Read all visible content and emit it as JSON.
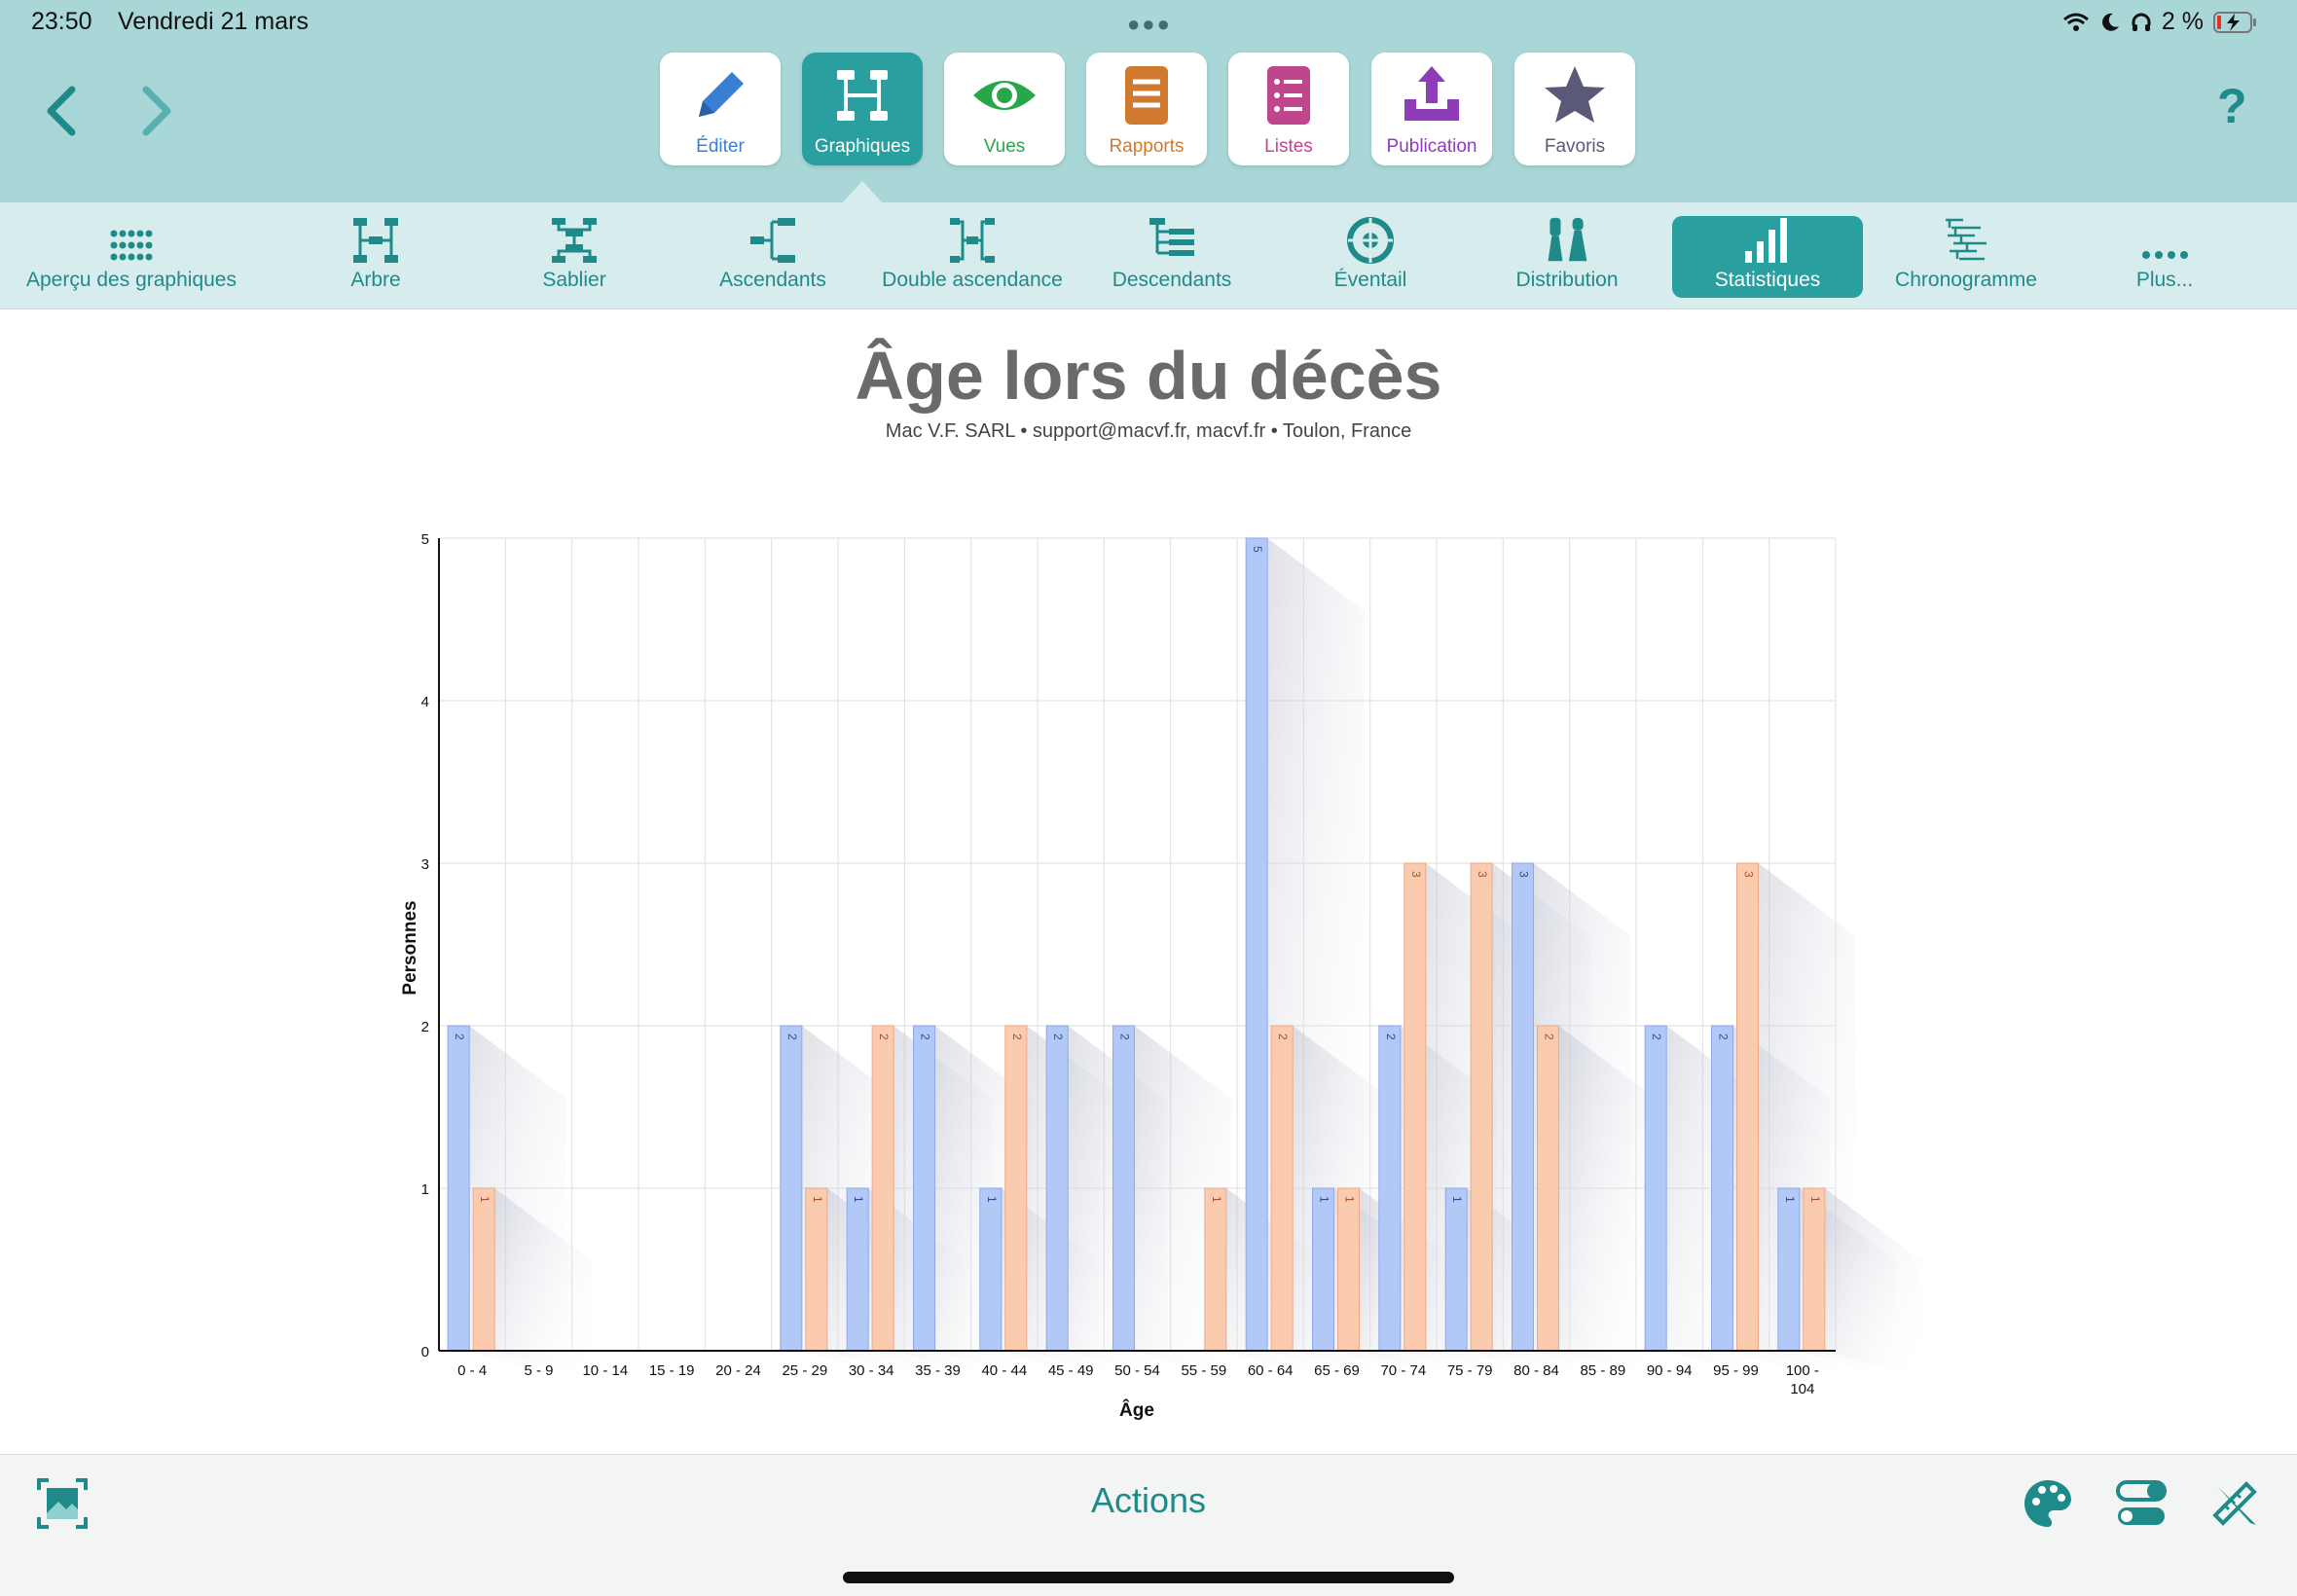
{
  "status_bar": {
    "time": "23:50",
    "date": "Vendredi 21 mars",
    "battery": "2 %"
  },
  "toolbar": {
    "modes": [
      {
        "label": "Éditer",
        "icon": "pencil-icon",
        "color": "#3a7fd4"
      },
      {
        "label": "Graphiques",
        "icon": "tree-chart-icon",
        "color": "#ffffff",
        "active": true
      },
      {
        "label": "Vues",
        "icon": "eye-icon",
        "color": "#2aa64a"
      },
      {
        "label": "Rapports",
        "icon": "report-icon",
        "color": "#d07a30"
      },
      {
        "label": "Listes",
        "icon": "list-icon",
        "color": "#c0468c"
      },
      {
        "label": "Publication",
        "icon": "upload-icon",
        "color": "#8e3cb8"
      },
      {
        "label": "Favoris",
        "icon": "star-icon",
        "color": "#5a5a78"
      }
    ],
    "help": "?"
  },
  "subbar": {
    "items": [
      {
        "label": "Aperçu des graphiques",
        "icon": "grid-dots-icon"
      },
      {
        "label": "Arbre",
        "icon": "tree-icon"
      },
      {
        "label": "Sablier",
        "icon": "hourglass-icon"
      },
      {
        "label": "Ascendants",
        "icon": "ancestors-icon"
      },
      {
        "label": "Double ascendance",
        "icon": "double-ancestry-icon"
      },
      {
        "label": "Descendants",
        "icon": "descendants-icon"
      },
      {
        "label": "Éventail",
        "icon": "fan-icon"
      },
      {
        "label": "Distribution",
        "icon": "distribution-icon"
      },
      {
        "label": "Statistiques",
        "icon": "bar-stats-icon",
        "active": true
      },
      {
        "label": "Chronogramme",
        "icon": "timeline-icon"
      },
      {
        "label": "Plus...",
        "icon": "more-dots-icon"
      }
    ]
  },
  "bottom_bar": {
    "actions_label": "Actions"
  },
  "colors": {
    "accent": "#1f8a8a",
    "toolbar_bg": "#a9d7d7",
    "subbar_bg": "#d7eded",
    "bar_blue": "#b2c8f6",
    "bar_orange": "#fbcbb0"
  },
  "chart_data": {
    "type": "bar",
    "title": "Âge lors du décès",
    "subtitle": "Mac V.F. SARL • support@macvf.fr, macvf.fr • Toulon, France",
    "xlabel": "Âge",
    "ylabel": "Personnes",
    "ylim": [
      0,
      5
    ],
    "yticks": [
      0,
      1,
      2,
      3,
      4,
      5
    ],
    "grid": true,
    "categories": [
      "0 - 4",
      "5 - 9",
      "10 - 14",
      "15 - 19",
      "20 - 24",
      "25 - 29",
      "30 - 34",
      "35 - 39",
      "40 - 44",
      "45 - 49",
      "50 - 54",
      "55 - 59",
      "60 - 64",
      "65 - 69",
      "70 - 74",
      "75 - 79",
      "80 - 84",
      "85 - 89",
      "90 - 94",
      "95 - 99",
      "100 - 104"
    ],
    "series": [
      {
        "color": "#b2c8f6",
        "values": [
          2,
          0,
          0,
          0,
          0,
          2,
          1,
          2,
          1,
          2,
          2,
          0,
          5,
          1,
          2,
          1,
          3,
          0,
          2,
          2,
          1
        ]
      },
      {
        "color": "#fbcbb0",
        "values": [
          1,
          0,
          0,
          0,
          0,
          1,
          2,
          0,
          2,
          0,
          0,
          1,
          2,
          1,
          3,
          3,
          2,
          0,
          0,
          3,
          1
        ]
      }
    ]
  }
}
